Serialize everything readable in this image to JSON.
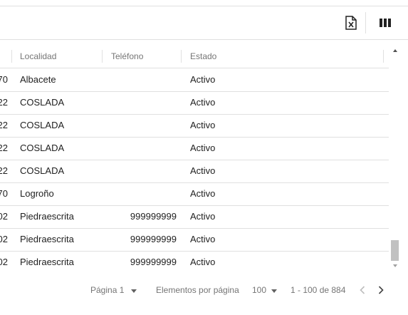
{
  "grid": {
    "columns": [
      "Localidad",
      "Teléfono",
      "Estado"
    ],
    "rows": [
      {
        "cut": "70",
        "localidad": "Albacete",
        "telefono": "",
        "estado": "Activo"
      },
      {
        "cut": "22",
        "localidad": "COSLADA",
        "telefono": "",
        "estado": "Activo"
      },
      {
        "cut": "22",
        "localidad": "COSLADA",
        "telefono": "",
        "estado": "Activo"
      },
      {
        "cut": "22",
        "localidad": "COSLADA",
        "telefono": "",
        "estado": "Activo"
      },
      {
        "cut": "22",
        "localidad": "COSLADA",
        "telefono": "",
        "estado": "Activo"
      },
      {
        "cut": "70",
        "localidad": "Logroño",
        "telefono": "",
        "estado": "Activo"
      },
      {
        "cut": "02",
        "localidad": "Piedraescrita",
        "telefono": "999999999",
        "estado": "Activo"
      },
      {
        "cut": "02",
        "localidad": "Piedraescrita",
        "telefono": "999999999",
        "estado": "Activo"
      },
      {
        "cut": "02",
        "localidad": "Piedraescrita",
        "telefono": "999999999",
        "estado": "Activo"
      }
    ]
  },
  "toolbar": {
    "icons": [
      "excel-export-icon",
      "columns-icon"
    ]
  },
  "footer": {
    "page_label": "Página 1",
    "items_per_page_label": "Elementos por página",
    "items_per_page_value": "100",
    "range_label": "1 - 100 de 884"
  },
  "colors": {
    "header_text": "#757575",
    "cell_text": "#212121",
    "border": "#e0e0e0"
  }
}
